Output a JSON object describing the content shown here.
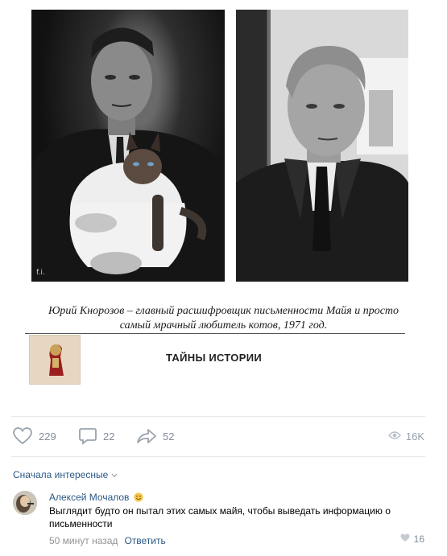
{
  "post": {
    "photo_watermark": "f.i.",
    "caption_line1": "Юрий Кнорозов – главный расшифровщик письменности Майя и просто",
    "caption_line2": "самый мрачный любитель котов, 1971 год.",
    "brand": "ТАЙНЫ ИСТОРИИ"
  },
  "actions": {
    "likes": "229",
    "comments": "22",
    "shares": "52",
    "views": "16K"
  },
  "comments": {
    "sort_label": "Сначала интересные",
    "items": [
      {
        "author": "Алексей Мочалов",
        "text": "Выглядит будто он пытал этих самых майя, чтобы выведать информацию о письменности",
        "time": "50 минут назад",
        "reply_label": "Ответить",
        "likes": "16"
      }
    ]
  },
  "icons": {
    "like": "heart-icon",
    "comment": "comment-icon",
    "share": "share-icon",
    "views": "eye-icon",
    "sort": "chevron-down-icon",
    "emoji": "smiling-face-icon"
  },
  "colors": {
    "link": "#2a5885",
    "muted": "#828a99",
    "divider": "#e7e8ec"
  }
}
